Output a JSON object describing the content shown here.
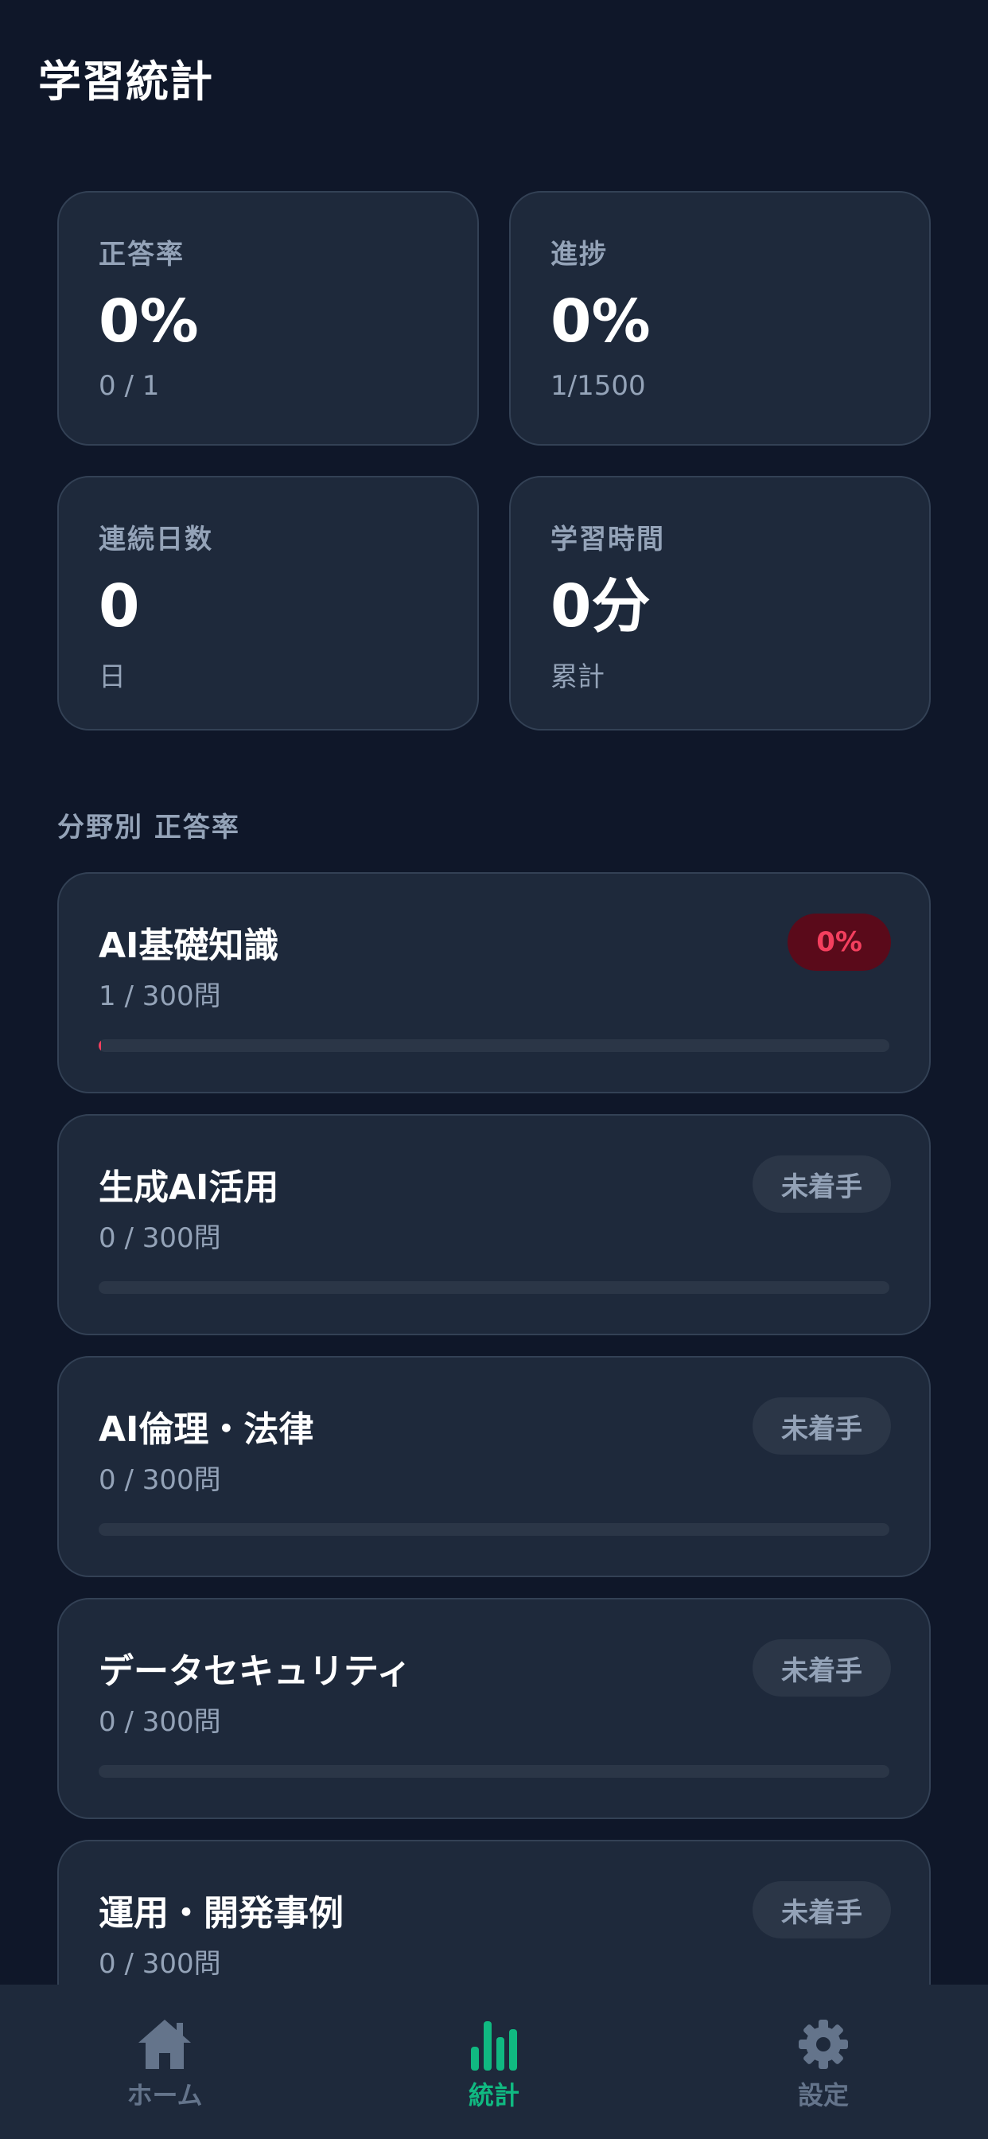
{
  "header": {
    "title": "学習統計"
  },
  "stats": [
    {
      "label": "正答率",
      "value": "0%",
      "sub": "0 / 1"
    },
    {
      "label": "進捗",
      "value": "0%",
      "sub": "1/1500"
    },
    {
      "label": "連続日数",
      "value": "0",
      "sub": "日"
    },
    {
      "label": "学習時間",
      "value": "0分",
      "sub": "累計"
    }
  ],
  "section": {
    "title": "分野別 正答率"
  },
  "subjects": [
    {
      "name": "AI基礎知識",
      "count": "1 / 300問",
      "badge": "0%",
      "status": "danger",
      "progress": 0.003
    },
    {
      "name": "生成AI活用",
      "count": "0 / 300問",
      "badge": "未着手",
      "status": "neutral",
      "progress": 0
    },
    {
      "name": "AI倫理・法律",
      "count": "0 / 300問",
      "badge": "未着手",
      "status": "neutral",
      "progress": 0
    },
    {
      "name": "データセキュリティ",
      "count": "0 / 300問",
      "badge": "未着手",
      "status": "neutral",
      "progress": 0
    },
    {
      "name": "運用・開発事例",
      "count": "0 / 300問",
      "badge": "未着手",
      "status": "neutral",
      "progress": 0
    }
  ],
  "tabbar": {
    "active_color": "#10b981",
    "inactive_color": "#64748b",
    "tabs": [
      {
        "label": "ホーム",
        "icon": "home-icon",
        "active": false
      },
      {
        "label": "統計",
        "icon": "bar-chart-icon",
        "active": true
      },
      {
        "label": "設定",
        "icon": "gear-icon",
        "active": false
      }
    ]
  }
}
